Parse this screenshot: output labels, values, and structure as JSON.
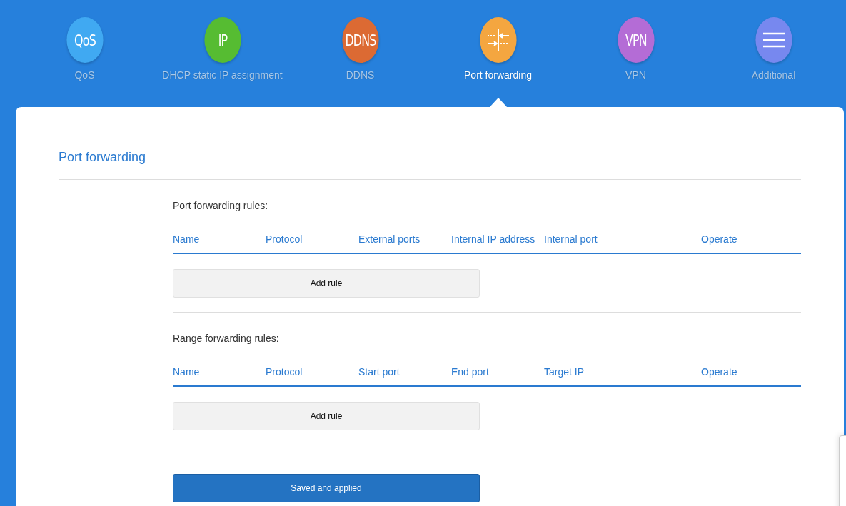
{
  "nav": [
    {
      "label": "QoS",
      "icon": {
        "kind": "text",
        "text": "QoS"
      },
      "color": "#40a9f2",
      "selected": false
    },
    {
      "label": "DHCP static IP assignment",
      "icon": {
        "kind": "text",
        "text": "IP"
      },
      "color": "#56bc32",
      "selected": false
    },
    {
      "label": "DDNS",
      "icon": {
        "kind": "text",
        "text": "DDNS"
      },
      "color": "#dc6a33",
      "selected": false
    },
    {
      "label": "Port forwarding",
      "icon": {
        "kind": "forward"
      },
      "color": "#f4a640",
      "selected": true
    },
    {
      "label": "VPN",
      "icon": {
        "kind": "text",
        "text": "VPN"
      },
      "color": "#b46cd6",
      "selected": false
    },
    {
      "label": "Additional",
      "icon": {
        "kind": "menu"
      },
      "color": "#7788ef",
      "selected": false
    }
  ],
  "page_title": "Port forwarding",
  "sections": [
    {
      "title": "Port forwarding rules:",
      "columns": [
        "Name",
        "Protocol",
        "External ports",
        "Internal IP address",
        "Internal port",
        "Operate"
      ],
      "add_button": "Add rule"
    },
    {
      "title": "Range forwarding rules:",
      "columns": [
        "Name",
        "Protocol",
        "Start port",
        "End port",
        "Target IP",
        "Operate"
      ],
      "add_button": "Add rule"
    }
  ],
  "save_button": "Saved and applied"
}
